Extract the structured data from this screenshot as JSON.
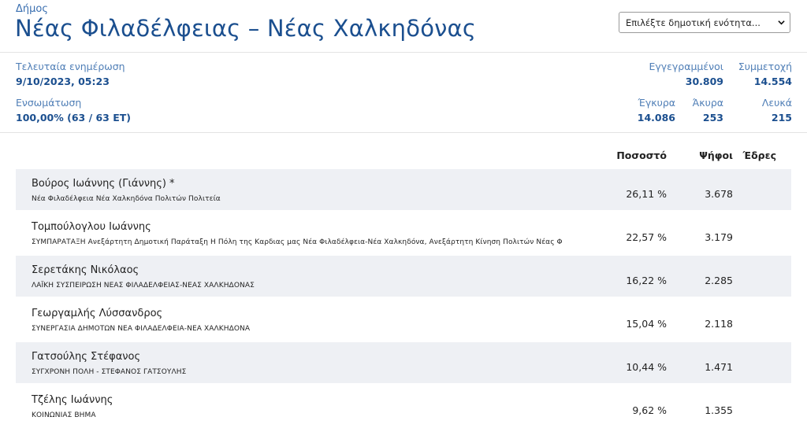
{
  "header": {
    "kicker": "Δήμος",
    "title": "Νέας Φιλαδέλφειας – Νέας Χαλκηδόνας",
    "select_value": "Επιλέξτε δημοτική ενότητα..."
  },
  "stats": {
    "last_update_label": "Τελευταία ενημέρωση",
    "last_update_value": "9/10/2023, 05:23",
    "integration_label": "Ενσωμάτωση",
    "integration_value": "100,00% (63 / 63 ΕΤ)",
    "registered_label": "Εγγεγραμμένοι",
    "registered_value": "30.809",
    "turnout_label": "Συμμετοχή",
    "turnout_value": "14.554",
    "valid_label": "Έγκυρα",
    "valid_value": "14.086",
    "invalid_label": "Άκυρα",
    "invalid_value": "253",
    "blank_label": "Λευκά",
    "blank_value": "215"
  },
  "table": {
    "headers": {
      "percent": "Ποσοστό",
      "votes": "Ψήφοι",
      "seats": "Έδρες"
    },
    "rows": [
      {
        "name": "Βούρος Ιωάννης (Γιάννης)  *",
        "party": "Νέα Φιλαδέλφεια Νέα Χαλκηδόνα Πολιτών Πολιτεία",
        "percent": "26,11 %",
        "votes": "3.678"
      },
      {
        "name": "Τομπούλογλου Ιωάννης",
        "party": "ΣΥΜΠΑΡΑΤΑΞΗ Ανεξάρτητη Δημοτική Παράταξη Η Πόλη της Καρδιας μας Νέα Φιλαδέλφεια-Νέα Χαλκηδόνα, Ανεξάρτητη Κίνηση Πολιτών Νέας Φ",
        "percent": "22,57 %",
        "votes": "3.179"
      },
      {
        "name": "Σερετάκης Νικόλαος",
        "party": "ΛΑΪΚΗ ΣΥΣΠΕΙΡΩΣΗ ΝΕΑΣ ΦΙΛΑΔΕΛΦΕΙΑΣ-ΝΕΑΣ ΧΑΛΚΗΔΟΝΑΣ",
        "percent": "16,22 %",
        "votes": "2.285"
      },
      {
        "name": "Γεωργαμλής Λύσσανδρος",
        "party": "ΣΥΝΕΡΓΑΣΙΑ ΔΗΜΟΤΩΝ ΝΕΑ ΦΙΛΑΔΕΛΦΕΙΑ-ΝΕΑ ΧΑΛΚΗΔΟΝΑ",
        "percent": "15,04 %",
        "votes": "2.118"
      },
      {
        "name": "Γατσούλης Στέφανος",
        "party": "ΣΥΓΧΡΟΝΗ ΠΟΛΗ - ΣΤΕΦΑΝΟΣ ΓΑΤΣΟΥΛΗΣ",
        "percent": "10,44 %",
        "votes": "1.471"
      },
      {
        "name": "Τζέλης Ιωάννης",
        "party": "ΚΟΙΝΩΝΙΑΣ ΒΗΜΑ",
        "percent": "9,62 %",
        "votes": "1.355"
      }
    ]
  }
}
